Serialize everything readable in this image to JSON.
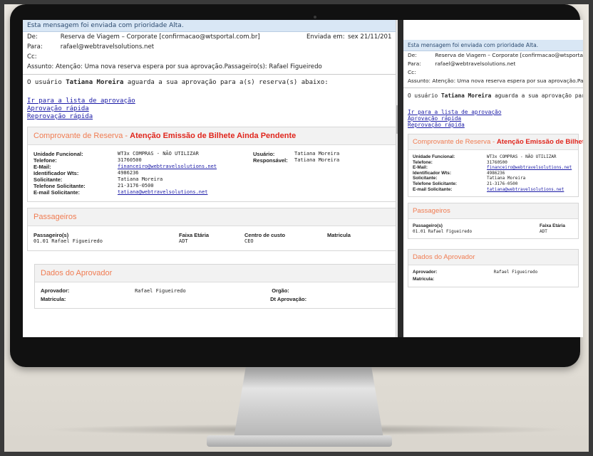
{
  "email": {
    "priority_notice": "Esta mensagem foi enviada com prioridade Alta.",
    "de_label": "De:",
    "de_value": "Reserva de Viagem – Corporate [confirmacao@wtsportal.com.br]",
    "enviada_label": "Enviada em:",
    "enviada_value": "sex 21/11/201",
    "para_label": "Para:",
    "para_value": "rafael@webtravelsolutions.net",
    "cc_label": "Cc:",
    "assunto_label": "Assunto:",
    "assunto_value": "Atenção: Uma nova reserva espera por sua aprovação.Passageiro(s): Rafael Figueiredo",
    "intro_prefix": "O usuário",
    "intro_user": "Tatiana Moreira",
    "intro_suffix": "aguarda a sua aprovação para a(s) reserva(s) abaixo:",
    "link_list": "Ir para a lista de aprovação",
    "link_approve": "Aprovação rápida",
    "link_reject": "Reprovação rápida",
    "comprovante_title": "Comprovante de Reserva -",
    "comprovante_alert": "Atenção Emissão de Bilhete Ainda Pendente",
    "details": {
      "unidade_label": "Unidade Funcional:",
      "unidade_value": "WT3x COMPRAS - NÃO UTILIZAR",
      "telefone_label": "Telefone:",
      "telefone_value": "31760500",
      "email_label": "E-Mail:",
      "email_value": "financeiro@webtravelsolutions.net",
      "identificador_label": "Identificador Wts:",
      "identificador_value": "4986236",
      "solicitante_label": "Solicitante:",
      "solicitante_value": "Tatiana Moreira",
      "tel_solic_label": "Telefone Solicitante:",
      "tel_solic_value": "21-3176-0500",
      "email_solic_label": "E-mail Solicitante:",
      "email_solic_value": "tatiana@webtravelsolutions.net",
      "usuario_label": "Usuário:",
      "usuario_value": "Tatiana Moreira",
      "responsavel_label": "Responsável:",
      "responsavel_value": "Tatiana Moreira"
    },
    "passageiros_title": "Passageiros",
    "passageiros": {
      "col1_h": "Passageiro(s)",
      "col1_v": "01.01 Rafael  Figueiredo",
      "col2_h": "Faixa Etária",
      "col2_v": "ADT",
      "col3_h": "Centro de custo",
      "col3_v": "CEO",
      "col4_h": "Matricula"
    },
    "aprovador_title": "Dados do Aprovador",
    "aprovador": {
      "aprovador_label": "Aprovador:",
      "aprovador_value": "Rafael Figueiredo",
      "orgao_label": "Orgão:",
      "matricula_label": "Matricula:",
      "dt_label": "Dt Aprovação:"
    }
  },
  "colors": {
    "accent_orange": "#f07c52",
    "alert_red": "#e0261d",
    "link_blue": "#1a1aa6",
    "priority_bar": "#d9e7f5"
  }
}
